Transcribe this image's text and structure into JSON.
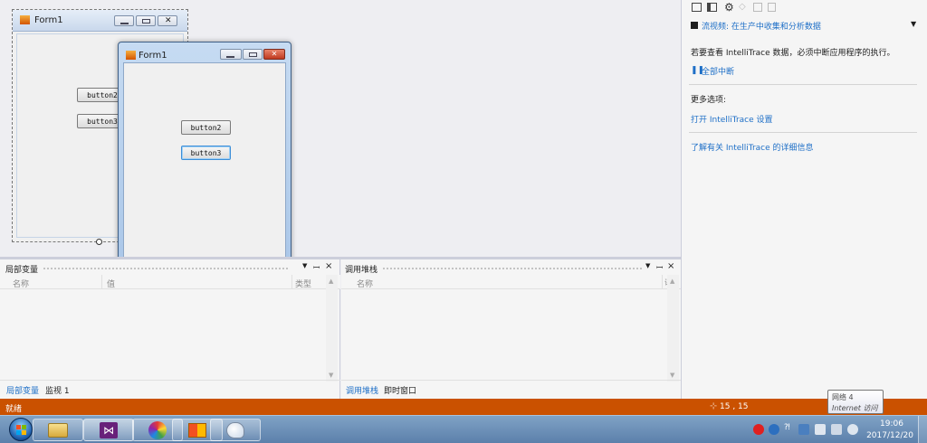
{
  "designer": {
    "form_back": {
      "title": "Form1",
      "button2": "button2",
      "button3": "button3"
    },
    "form_front": {
      "title": "Form1",
      "button2": "button2",
      "button3": "button3"
    }
  },
  "intellitrace": {
    "header_link": "流视频: 在生产中收集和分析数据",
    "message": "若要查看 IntelliTrace 数据，必须中断应用程序的执行。",
    "break_all": "全部中断",
    "more_options": "更多选项:",
    "open_settings": "打开 IntelliTrace 设置",
    "learn_more": "了解有关 IntelliTrace 的详细信息"
  },
  "locals_panel": {
    "title": "局部变量",
    "columns": [
      "名称",
      "值",
      "类型"
    ],
    "tabs": [
      "局部变量",
      "监视 1"
    ]
  },
  "callstack_panel": {
    "title": "调用堆栈",
    "columns": [
      "名称",
      "语言"
    ],
    "tabs": [
      "调用堆栈",
      "即时窗口"
    ]
  },
  "statusbar": {
    "left": "就绪",
    "position": "15 , 15"
  },
  "tooltip": {
    "line1": "网络 4",
    "line2": "Internet 访问"
  },
  "clock": {
    "time": "19:06",
    "date": "2017/12/20"
  },
  "colors": {
    "accent": "#ca5100",
    "link": "#1e6fc7",
    "taskbar": "#6b8fb8"
  }
}
